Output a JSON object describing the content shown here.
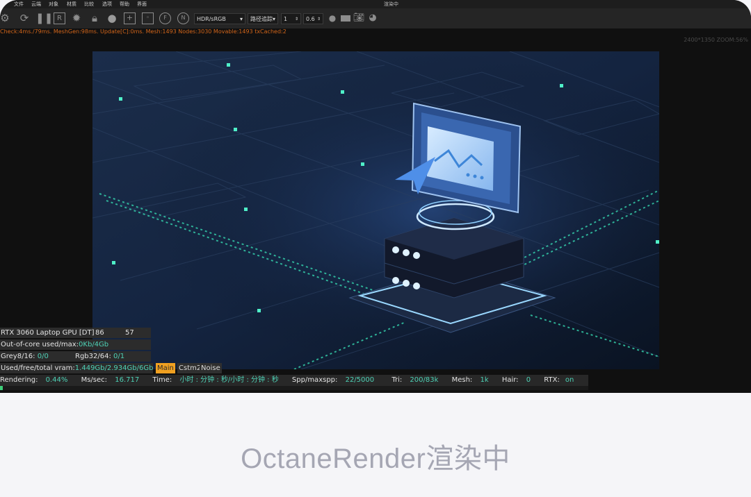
{
  "menu": {
    "items": [
      "文件",
      "云端",
      "对象",
      "材质",
      "比较",
      "选项",
      "帮助",
      "界面"
    ],
    "title": "渲染中"
  },
  "toolbar": {
    "colorspace": "HDR/sRGB",
    "kernel": "路径追踪",
    "value1": "1",
    "value2": "0.6"
  },
  "stats_line": "Check:4ms./79ms. MeshGen:98ms. Update[C]:0ms. Mesh:1493 Nodes:3030 Movable:1493 txCached:2",
  "resolution": "2400*1350 ZOOM:56%",
  "overlay": {
    "gpu_label": "RTX 3060 Laptop GPU [DT]",
    "gpu_value1": "86",
    "gpu_value2": "57",
    "ooc_label": "Out-of-core used/max:",
    "ooc_value": "0Kb/4Gb",
    "grey_label": "Grey8/16:",
    "grey_value": "0/0",
    "rgb_label": "Rgb32/64:",
    "rgb_value": "0/1",
    "vram_label": "Used/free/total vram:",
    "vram_value": "1.449Gb/2.934Gb/6Gb"
  },
  "tabs": [
    "Main",
    "Cstm2",
    "Noise"
  ],
  "render": {
    "rendering_label": "Rendering:",
    "rendering_value": "0.44%",
    "ms_label": "Ms/sec:",
    "ms_value": "16.717",
    "time_label": "Time:",
    "time_value": "小时 : 分钟 : 秒/小时 : 分钟 : 秒",
    "spp_label": "Spp/maxspp:",
    "spp_value": "22/5000",
    "tri_label": "Tri:",
    "tri_value": "200/83k",
    "mesh_label": "Mesh:",
    "mesh_value": "1k",
    "hair_label": "Hair:",
    "hair_value": "0",
    "rtx_label": "RTX:",
    "rtx_value": "on",
    "progress": 0.0044
  },
  "caption": "OctaneRender渲染中",
  "colors": {
    "accent": "#f0a020",
    "value": "#4ed2b6",
    "stats": "#d2651a"
  }
}
